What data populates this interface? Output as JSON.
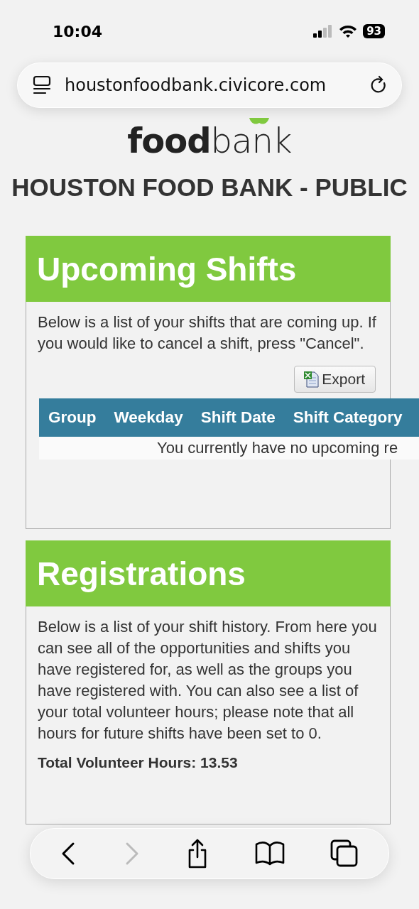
{
  "status_bar": {
    "time": "10:04",
    "battery": "93"
  },
  "address_bar": {
    "url": "houstonfoodbank.civicore.com"
  },
  "logo": {
    "text": "**food**bank"
  },
  "site_title": "HOUSTON FOOD BANK - PUBLIC",
  "upcoming_shifts": {
    "title": "Upcoming Shifts",
    "description": "Below is a list of your shifts that are coming up. If you would like to cancel a shift, press \"Cancel\".",
    "export_button": "Export",
    "table": {
      "columns": [
        "Group",
        "Weekday",
        "Shift Date",
        "Shift Category"
      ],
      "empty_message": "You currently have no upcoming re"
    }
  },
  "registrations": {
    "title": "Registrations",
    "description": "Below is a list of your shift history. From here you can see all of the opportunities and shifts you have registered for, as well as the groups you have registered with. You can also see a list of your total volunteer hours; please note that all hours for future shifts have been set to 0.",
    "total_hours": "Total Volunteer Hours: 13.53"
  },
  "toolbar": {
    "forward_disabled": true
  }
}
